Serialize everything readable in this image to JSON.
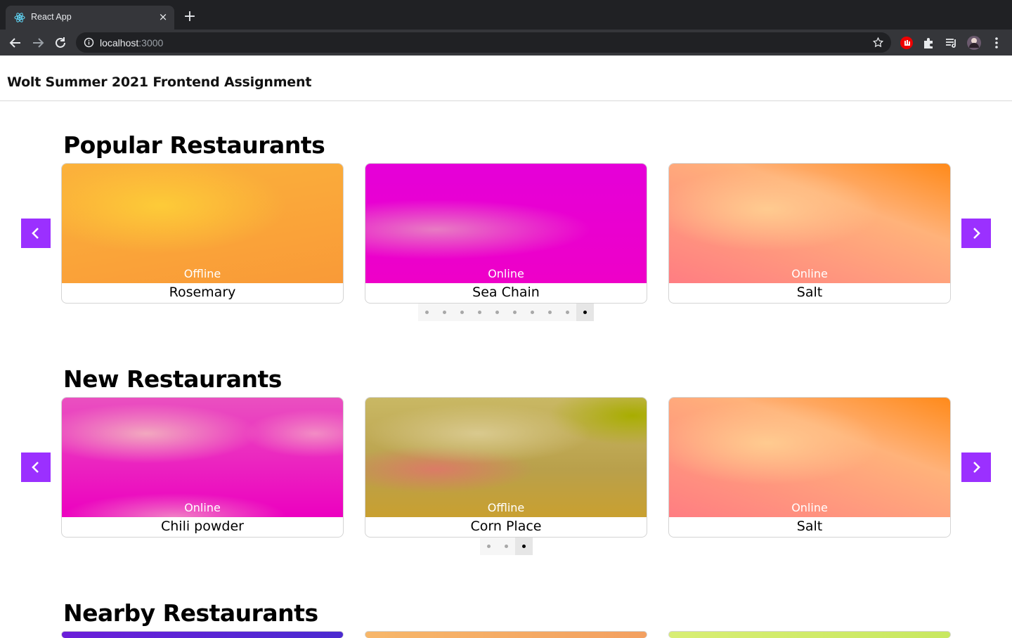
{
  "browser": {
    "tab_title": "React App",
    "tab_close": "×",
    "new_tab": "+",
    "url_host": "localhost",
    "url_port": ":3000"
  },
  "app": {
    "title": "Wolt Summer 2021 Frontend Assignment"
  },
  "sections": [
    {
      "title": "Popular Restaurants",
      "cards": [
        {
          "status": "Offline",
          "name": "Rosemary",
          "colors": [
            "#fcc23a",
            "#f99a39"
          ]
        },
        {
          "status": "Online",
          "name": "Sea Chain",
          "colors": [
            "#e05ab8",
            "#e600d6"
          ]
        },
        {
          "status": "Online",
          "name": "Salt",
          "colors": [
            "#fdc08a",
            "#ff7c80"
          ]
        }
      ],
      "page_count": 10,
      "active_page": 10
    },
    {
      "title": "New Restaurants",
      "cards": [
        {
          "status": "Online",
          "name": "Chili powder",
          "colors": [
            "#f0a0c8",
            "#ea00c0"
          ]
        },
        {
          "status": "Offline",
          "name": "Corn Place",
          "colors": [
            "#d4cc86",
            "#b09d20"
          ]
        },
        {
          "status": "Online",
          "name": "Salt",
          "colors": [
            "#fdc08a",
            "#ff7c80"
          ]
        }
      ],
      "page_count": 3,
      "active_page": 3
    },
    {
      "title": "Nearby Restaurants"
    }
  ]
}
